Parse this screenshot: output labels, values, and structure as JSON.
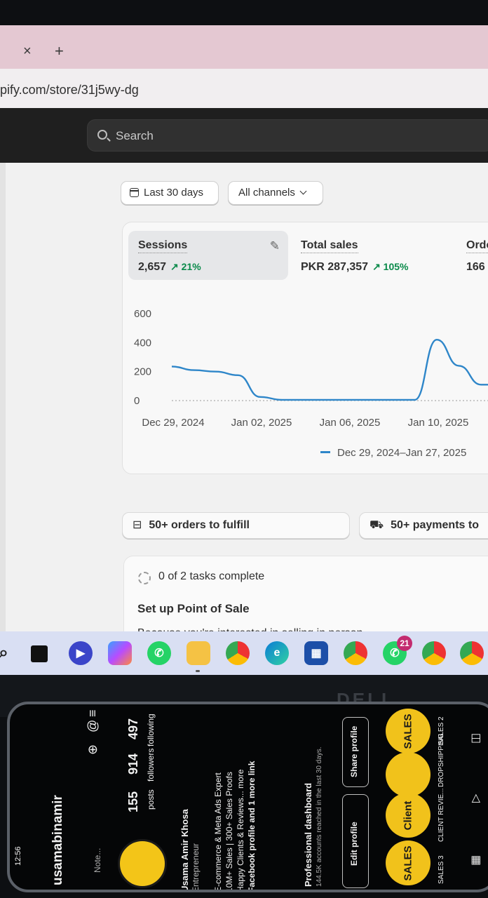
{
  "browser": {
    "tab_close": "×",
    "tab_new": "+",
    "url": "pify.com/store/31j5wy-dg"
  },
  "admin": {
    "search_placeholder": "Search"
  },
  "filters": {
    "date_range": "Last 30 days",
    "channels": "All channels"
  },
  "metrics": [
    {
      "title": "Sessions",
      "value": "2,657",
      "delta": "↗ 21%"
    },
    {
      "title": "Total sales",
      "value": "PKR 287,357",
      "delta": "↗ 105%"
    },
    {
      "title": "Orde",
      "value": "166"
    }
  ],
  "chart_data": {
    "type": "line",
    "y_ticks": [
      "600",
      "400",
      "200",
      "0"
    ],
    "x_ticks": [
      "Dec 29, 2024",
      "Jan 02, 2025",
      "Jan 06, 2025",
      "Jan 10, 2025"
    ],
    "ylim": [
      0,
      600
    ],
    "series": [
      {
        "name": "Dec 29, 2024–Jan 27, 2025",
        "color": "#2e86c9",
        "x": [
          "2024-12-29",
          "2024-12-30",
          "2024-12-31",
          "2025-01-01",
          "2025-01-02",
          "2025-01-03",
          "2025-01-04",
          "2025-01-05",
          "2025-01-06",
          "2025-01-07",
          "2025-01-08",
          "2025-01-09",
          "2025-01-10",
          "2025-01-11",
          "2025-01-12",
          "2025-01-13"
        ],
        "values": [
          235,
          210,
          200,
          175,
          25,
          5,
          5,
          5,
          5,
          5,
          5,
          5,
          420,
          240,
          110,
          110
        ]
      }
    ],
    "grid": false
  },
  "actions": {
    "orders": "50+ orders to fulfill",
    "payments": "50+ payments to"
  },
  "setup": {
    "progress": "0 of 2 tasks complete",
    "title": "Set up Point of Sale",
    "description": "Because you're interested in selling in person"
  },
  "taskbar": {
    "badge_count": "21"
  },
  "phone": {
    "status": "12:56",
    "username": "usamabinamir",
    "posts_count": "155",
    "posts_label": "posts",
    "followers_count": "914",
    "followers_label": "followers",
    "following_count": "497",
    "following_label": "following",
    "note": "Note...",
    "name": "Usama Amir Khosa",
    "role": "Entrepreneur",
    "bio_1": "E-commerce & Meta Ads Expert",
    "bio_2": "10M+ Sales | 300+ Sales Proofs",
    "bio_3": "Happy Clients & Reviews... more",
    "bio_4": "Facebook profile and 1 more link",
    "dashboard_title": "Professional dashboard",
    "dashboard_sub": "144.5K accounts reached in the last 30 days.",
    "edit_profile": "Edit profile",
    "share_profile": "Share profile",
    "highlight_1": "SALES",
    "highlight_2": "Client",
    "highlight_4": "SALES",
    "highlight_label_1": "SALES 3",
    "highlight_label_2": "CLIENT REVIE...",
    "highlight_label_3": "DROPSHIPPING",
    "highlight_label_4": "SALES 2",
    "monitor_brand": "DELL"
  }
}
